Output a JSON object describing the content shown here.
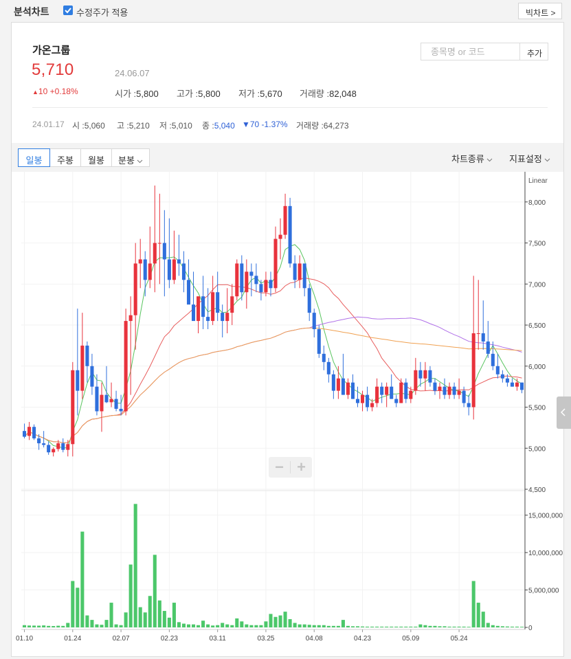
{
  "topbar": {
    "title": "분석차트",
    "adjusted_label": "수정주가 적용",
    "big_chart_label": "빅차트 >"
  },
  "stock": {
    "name": "가온그룹",
    "price": "5,710",
    "date": "24.06.07",
    "change": "10 +0.18%",
    "open_label": "시가 :",
    "open": "5,800",
    "high_label": "고가 :",
    "high": "5,800",
    "low_label": "저가 :",
    "low": "5,670",
    "volume_label": "거래량 :",
    "volume": "82,048"
  },
  "search": {
    "placeholder": "종목명 or 코드",
    "add_label": "추가"
  },
  "prev_day": {
    "date": "24.01.17",
    "open_label": "시 :",
    "open": "5,060",
    "high_label": "고 :",
    "high": "5,210",
    "low_label": "저 :",
    "low": "5,010",
    "close_label": "종 :",
    "close": "5,040",
    "change": "▼70 -1.37%",
    "volume_label": "거래량 :",
    "volume": "64,273"
  },
  "tabs": [
    {
      "label": "일봉",
      "active": true
    },
    {
      "label": "주봉",
      "active": false
    },
    {
      "label": "월봉",
      "active": false
    },
    {
      "label": "분봉",
      "active": false,
      "dropdown": true
    }
  ],
  "chart_type_label": "차트종류",
  "indicator_label": "지표설정",
  "zoom": {
    "out_label": "−",
    "in_label": "+"
  },
  "colors": {
    "up": "#e8323c",
    "down": "#2f6fdc",
    "volume": "#4cc76a",
    "ma5": "#58c45e",
    "ma20": "#e85d5d",
    "ma60": "#b070e8",
    "ma120": "#f0a050"
  },
  "chart_data": {
    "type": "candlestick",
    "scale": "Linear",
    "ylim": [
      4500,
      8300
    ],
    "y_ticks": [
      8000,
      7500,
      7000,
      6500,
      6000,
      5500,
      5000,
      4500
    ],
    "y_tick_labels": [
      "8,000",
      "7,500",
      "7,000",
      "6,500",
      "6,000",
      "5,500",
      "5,000",
      "4,500"
    ],
    "volume_ylim": [
      0,
      18000000
    ],
    "volume_ticks": [
      0,
      5000000,
      10000000,
      15000000
    ],
    "volume_tick_labels": [
      "0",
      "5,000,000",
      "10,000,000",
      "15,000,000"
    ],
    "x_tick_labels": [
      {
        "i": 0,
        "label": "01.10"
      },
      {
        "i": 10,
        "label": "01.24"
      },
      {
        "i": 20,
        "label": "02.07"
      },
      {
        "i": 30,
        "label": "02.23"
      },
      {
        "i": 40,
        "label": "03.11"
      },
      {
        "i": 50,
        "label": "03.25"
      },
      {
        "i": 60,
        "label": "04.08"
      },
      {
        "i": 70,
        "label": "04.23"
      },
      {
        "i": 80,
        "label": "05.09"
      },
      {
        "i": 90,
        "label": "05.24"
      }
    ],
    "ohlcv": [
      [
        5210,
        5300,
        5120,
        5140,
        300000
      ],
      [
        5150,
        5320,
        5100,
        5260,
        250000
      ],
      [
        5260,
        5290,
        5100,
        5120,
        240000
      ],
      [
        5120,
        5170,
        4980,
        5060,
        230000
      ],
      [
        5060,
        5210,
        5010,
        5040,
        264273
      ],
      [
        5040,
        5080,
        4920,
        4950,
        200000
      ],
      [
        4950,
        5010,
        4900,
        4990,
        180000
      ],
      [
        4990,
        5100,
        4960,
        5060,
        220000
      ],
      [
        5060,
        5120,
        4950,
        4980,
        200000
      ],
      [
        4980,
        5100,
        4900,
        5050,
        600000
      ],
      [
        5050,
        6050,
        4900,
        5950,
        6200000
      ],
      [
        5950,
        6700,
        5400,
        5700,
        5300000
      ],
      [
        5700,
        6650,
        5600,
        6250,
        12800000
      ],
      [
        6250,
        6300,
        5800,
        6000,
        1600000
      ],
      [
        6000,
        6150,
        5650,
        5750,
        1000000
      ],
      [
        5750,
        5900,
        5400,
        5450,
        400000
      ],
      [
        5450,
        5800,
        5200,
        5650,
        350000
      ],
      [
        5650,
        6000,
        5550,
        5560,
        1000000
      ],
      [
        5560,
        5800,
        5500,
        5600,
        3300000
      ],
      [
        5600,
        5700,
        5450,
        5480,
        400000
      ],
      [
        5480,
        5650,
        5400,
        5450,
        300000
      ],
      [
        5450,
        6700,
        5400,
        6550,
        2000000
      ],
      [
        6550,
        6850,
        5650,
        6620,
        8400000
      ],
      [
        6620,
        7500,
        6200,
        7250,
        16500000
      ],
      [
        7250,
        7550,
        6950,
        7300,
        2700000
      ],
      [
        7300,
        7400,
        6850,
        7050,
        2000000
      ],
      [
        7050,
        7700,
        6950,
        7250,
        4200000
      ],
      [
        7250,
        8200,
        6900,
        7500,
        9700000
      ],
      [
        7500,
        8100,
        7000,
        7500,
        3600000
      ],
      [
        7500,
        7900,
        6850,
        7300,
        2200000
      ],
      [
        7300,
        7800,
        6950,
        7050,
        1300000
      ],
      [
        7050,
        7650,
        7000,
        7300,
        3300000
      ],
      [
        7300,
        7600,
        7100,
        7250,
        700000
      ],
      [
        7250,
        7400,
        6900,
        7050,
        500000
      ],
      [
        7050,
        7300,
        6800,
        6750,
        400000
      ],
      [
        6750,
        7150,
        6700,
        6550,
        400000
      ],
      [
        6550,
        6850,
        6400,
        6850,
        300000
      ],
      [
        6850,
        7100,
        6450,
        6600,
        900000
      ],
      [
        6600,
        6950,
        6450,
        6550,
        400000
      ],
      [
        6550,
        7100,
        6500,
        6900,
        250000
      ],
      [
        6900,
        7150,
        6550,
        6650,
        300000
      ],
      [
        6650,
        6750,
        6350,
        6550,
        600000
      ],
      [
        6550,
        6950,
        6400,
        6650,
        400000
      ],
      [
        6650,
        7000,
        6500,
        6850,
        300000
      ],
      [
        6850,
        7300,
        6800,
        7250,
        1200000
      ],
      [
        7250,
        7350,
        6800,
        6900,
        800000
      ],
      [
        6900,
        7300,
        6700,
        7150,
        400000
      ],
      [
        7150,
        7250,
        6850,
        7100,
        300000
      ],
      [
        7100,
        7250,
        6900,
        7000,
        300000
      ],
      [
        7000,
        7050,
        6800,
        6900,
        300000
      ],
      [
        6900,
        7150,
        6850,
        7050,
        800000
      ],
      [
        7050,
        7150,
        6850,
        6950,
        1800000
      ],
      [
        6950,
        7700,
        6900,
        7550,
        1400000
      ],
      [
        7550,
        7800,
        7300,
        7600,
        1600000
      ],
      [
        7600,
        8100,
        7550,
        7950,
        2100000
      ],
      [
        7950,
        8050,
        7200,
        7250,
        1100000
      ],
      [
        7250,
        7350,
        6950,
        7050,
        600000
      ],
      [
        7050,
        7350,
        6950,
        7250,
        400000
      ],
      [
        7250,
        7200,
        6850,
        6950,
        400000
      ],
      [
        6950,
        7000,
        6550,
        6650,
        350000
      ],
      [
        6650,
        6700,
        6350,
        6450,
        300000
      ],
      [
        6450,
        6500,
        6100,
        6150,
        300000
      ],
      [
        6150,
        6250,
        5950,
        6050,
        300000
      ],
      [
        6050,
        6100,
        5800,
        5900,
        200000
      ],
      [
        5900,
        5950,
        5600,
        5700,
        200000
      ],
      [
        5700,
        6000,
        5600,
        5850,
        200000
      ],
      [
        5850,
        6150,
        5650,
        5650,
        1000000
      ],
      [
        5650,
        5850,
        5600,
        5800,
        200000
      ],
      [
        5800,
        5900,
        5600,
        5600,
        150000
      ],
      [
        5600,
        5750,
        5500,
        5550,
        150000
      ],
      [
        5550,
        5700,
        5450,
        5650,
        120000
      ],
      [
        5650,
        5750,
        5450,
        5500,
        100000
      ],
      [
        5500,
        5600,
        5450,
        5550,
        100000
      ],
      [
        5550,
        5850,
        5500,
        5750,
        100000
      ],
      [
        5750,
        5800,
        5550,
        5650,
        100000
      ],
      [
        5650,
        5800,
        5500,
        5750,
        100000
      ],
      [
        5750,
        5900,
        5600,
        5600,
        100000
      ],
      [
        5600,
        5650,
        5500,
        5550,
        100000
      ],
      [
        5550,
        5850,
        5550,
        5800,
        100000
      ],
      [
        5800,
        5850,
        5550,
        5600,
        100000
      ],
      [
        5600,
        5750,
        5550,
        5700,
        100000
      ],
      [
        5700,
        6100,
        5650,
        5950,
        100000
      ],
      [
        5950,
        6050,
        5750,
        5850,
        400000
      ],
      [
        5850,
        6050,
        5700,
        5950,
        300000
      ],
      [
        5950,
        6000,
        5750,
        5800,
        200000
      ],
      [
        5800,
        5850,
        5650,
        5700,
        200000
      ],
      [
        5700,
        5800,
        5600,
        5750,
        150000
      ],
      [
        5750,
        5850,
        5600,
        5650,
        150000
      ],
      [
        5650,
        5800,
        5600,
        5750,
        100000
      ],
      [
        5750,
        5800,
        5600,
        5650,
        100000
      ],
      [
        5650,
        5850,
        5600,
        5700,
        100000
      ],
      [
        5700,
        5750,
        5500,
        5550,
        100000
      ],
      [
        5550,
        5650,
        5400,
        5500,
        80000
      ],
      [
        5500,
        7100,
        5350,
        6400,
        6200000
      ],
      [
        6400,
        7050,
        6200,
        6400,
        3300000
      ],
      [
        6400,
        6800,
        6200,
        6300,
        2100000
      ],
      [
        6300,
        6550,
        6100,
        6150,
        600000
      ],
      [
        6150,
        6300,
        5950,
        6000,
        300000
      ],
      [
        6000,
        6150,
        5850,
        5900,
        200000
      ],
      [
        5900,
        5950,
        5800,
        5850,
        150000
      ],
      [
        5850,
        5900,
        5750,
        5800,
        120000
      ],
      [
        5800,
        5850,
        5750,
        5750,
        100000
      ],
      [
        5750,
        5850,
        5700,
        5800,
        100000
      ],
      [
        5800,
        5800,
        5670,
        5710,
        82048
      ]
    ],
    "ma": [
      {
        "period": 5,
        "color": "#58c45e"
      },
      {
        "period": 20,
        "color": "#e85d5d"
      },
      {
        "period": 60,
        "color": "#b070e8"
      },
      {
        "period": 120,
        "color": "#f0a050"
      }
    ]
  }
}
